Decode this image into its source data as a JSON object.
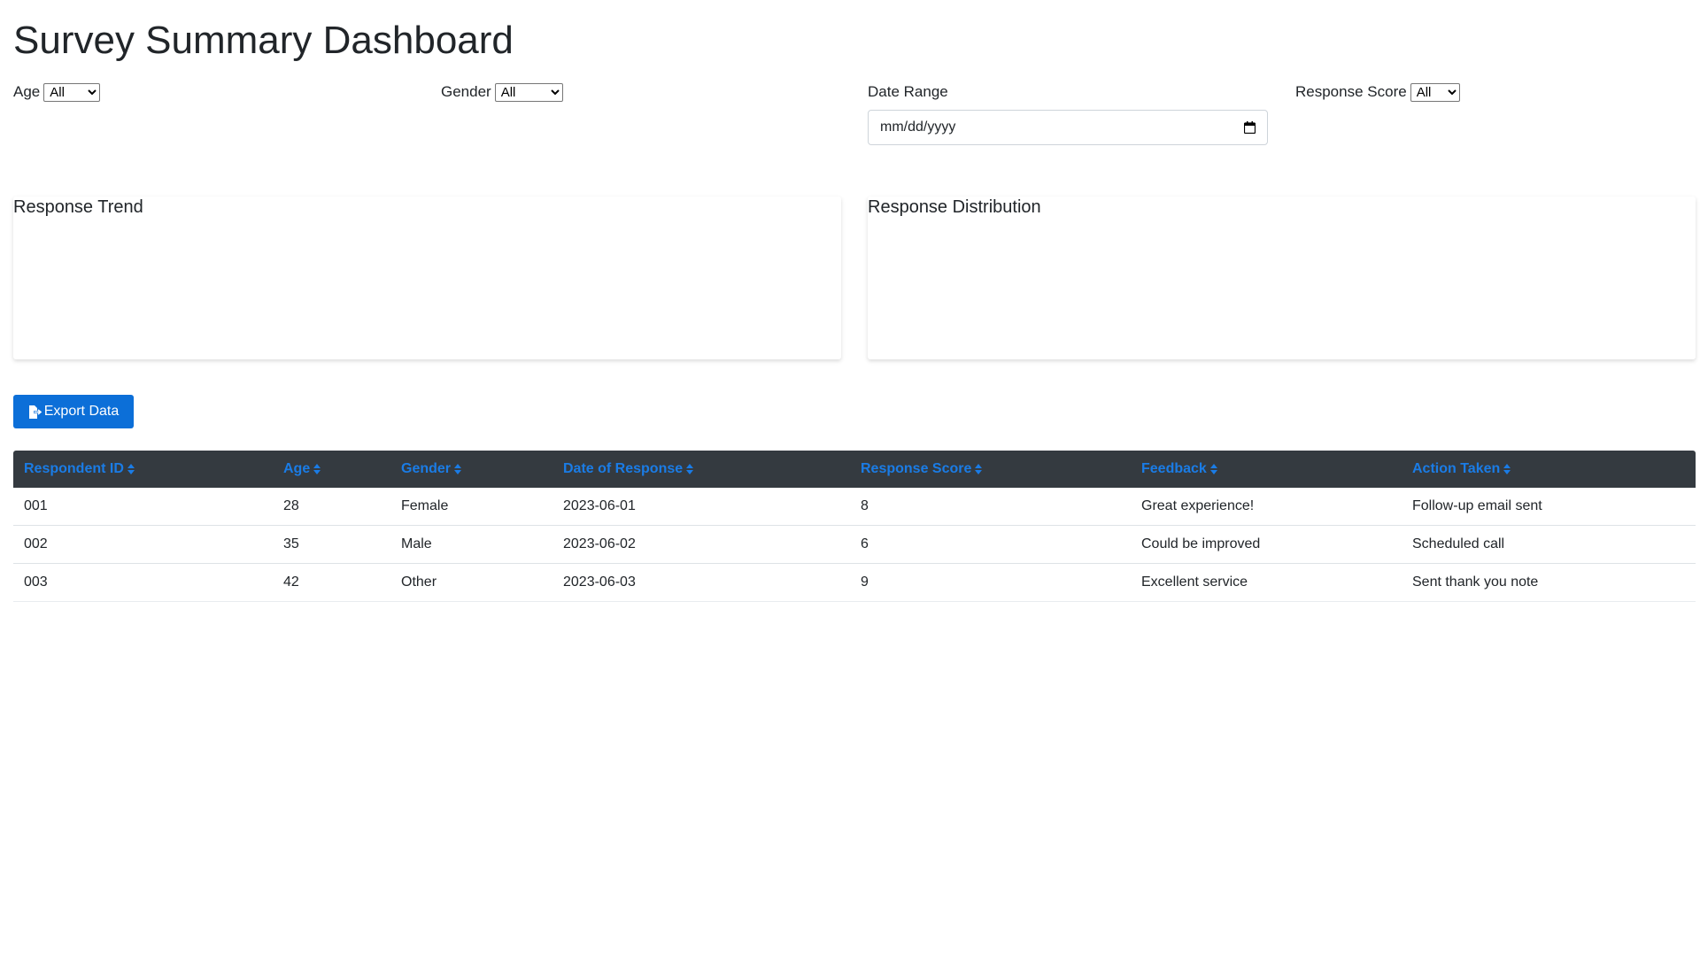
{
  "page": {
    "title": "Survey Summary Dashboard"
  },
  "filters": {
    "age": {
      "label": "Age",
      "selected": "All"
    },
    "gender": {
      "label": "Gender",
      "selected": "All"
    },
    "date_range": {
      "label": "Date Range",
      "placeholder": "mm/dd/yyyy"
    },
    "response_score": {
      "label": "Response Score",
      "selected": "All"
    }
  },
  "charts": {
    "trend": {
      "title": "Response Trend"
    },
    "distribution": {
      "title": "Response Distribution"
    }
  },
  "toolbar": {
    "export_label": "Export Data",
    "export_icon": "file-export-icon"
  },
  "table": {
    "columns": [
      "Respondent ID",
      "Age",
      "Gender",
      "Date of Response",
      "Response Score",
      "Feedback",
      "Action Taken"
    ],
    "sort_icon": "sort-icon",
    "rows": [
      [
        "001",
        "28",
        "Female",
        "2023-06-01",
        "8",
        "Great experience!",
        "Follow-up email sent"
      ],
      [
        "002",
        "35",
        "Male",
        "2023-06-02",
        "6",
        "Could be improved",
        "Scheduled call"
      ],
      [
        "003",
        "42",
        "Other",
        "2023-06-03",
        "9",
        "Excellent service",
        "Sent thank you note"
      ]
    ]
  },
  "colors": {
    "primary": "#0c6fd8",
    "header_bg": "#343a40",
    "header_text": "#1a7ce6",
    "text": "#212529",
    "row_border": "#dee2e6"
  }
}
